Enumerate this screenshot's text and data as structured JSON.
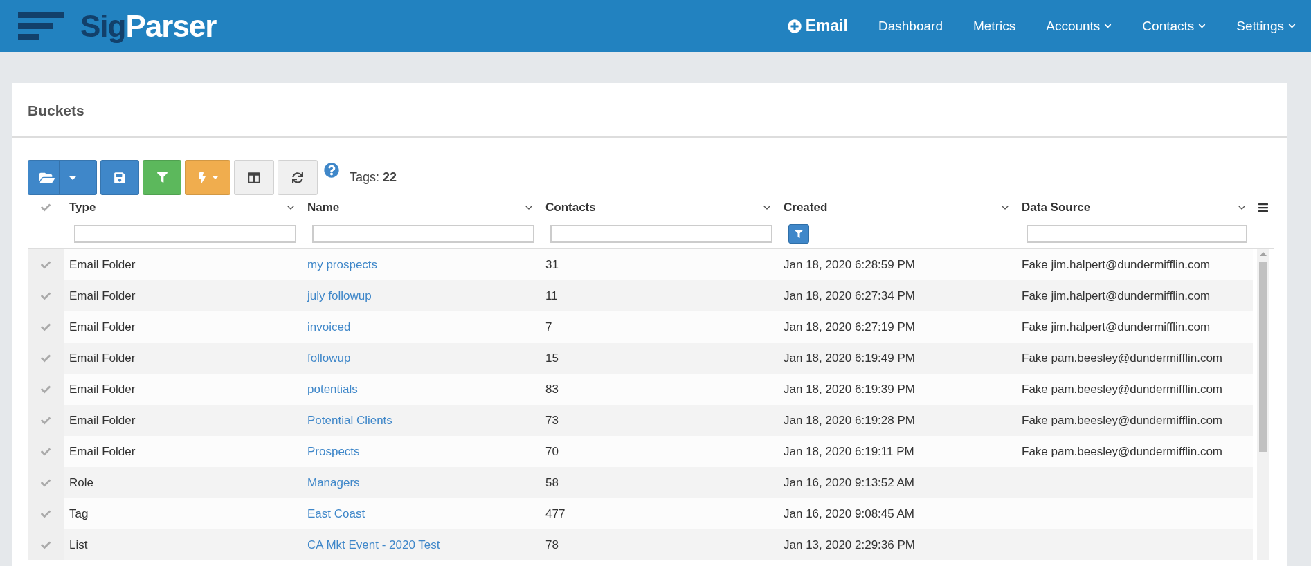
{
  "brand": {
    "part_1": "Sig",
    "part_2": "Parser"
  },
  "nav": [
    {
      "label": "Email",
      "kind": "primary"
    },
    {
      "label": "Dashboard",
      "kind": "link"
    },
    {
      "label": "Metrics",
      "kind": "link"
    },
    {
      "label": "Accounts",
      "kind": "dropdown"
    },
    {
      "label": "Contacts",
      "kind": "dropdown"
    },
    {
      "label": "Settings",
      "kind": "dropdown"
    }
  ],
  "panel": {
    "title": "Buckets"
  },
  "toolbar": {
    "buttons": [
      {
        "kind": "open",
        "color": "#3f87c9"
      },
      {
        "kind": "save",
        "color": "#3f87c9"
      },
      {
        "kind": "filter",
        "color": "#5cb85c"
      },
      {
        "kind": "actions",
        "color": "#f0ad4e"
      },
      {
        "kind": "columns",
        "color": "#f0f0f0"
      },
      {
        "kind": "refresh",
        "color": "#f0f0f0"
      }
    ],
    "tags_label": "Tags:",
    "tags_count": "22"
  },
  "table": {
    "columns": [
      {
        "label": "Type",
        "kind": "text"
      },
      {
        "label": "Name",
        "kind": "text"
      },
      {
        "label": "Contacts",
        "kind": "text"
      },
      {
        "label": "Created",
        "kind": "button"
      },
      {
        "label": "Data Source",
        "kind": "text"
      }
    ],
    "rows": [
      {
        "selected": false,
        "cells": [
          "Email Folder",
          "my prospects",
          "31",
          "Jan 18, 2020 6:28:59 PM",
          "Fake jim.halpert@dundermifflin.com"
        ]
      },
      {
        "selected": false,
        "cells": [
          "Email Folder",
          "july followup",
          "11",
          "Jan 18, 2020 6:27:34 PM",
          "Fake jim.halpert@dundermifflin.com"
        ]
      },
      {
        "selected": false,
        "cells": [
          "Email Folder",
          "invoiced",
          "7",
          "Jan 18, 2020 6:27:19 PM",
          "Fake jim.halpert@dundermifflin.com"
        ]
      },
      {
        "selected": false,
        "cells": [
          "Email Folder",
          "followup",
          "15",
          "Jan 18, 2020 6:19:49 PM",
          "Fake pam.beesley@dundermifflin.com"
        ]
      },
      {
        "selected": false,
        "cells": [
          "Email Folder",
          "potentials",
          "83",
          "Jan 18, 2020 6:19:39 PM",
          "Fake pam.beesley@dundermifflin.com"
        ]
      },
      {
        "selected": false,
        "cells": [
          "Email Folder",
          "Potential Clients",
          "73",
          "Jan 18, 2020 6:19:28 PM",
          "Fake pam.beesley@dundermifflin.com"
        ]
      },
      {
        "selected": false,
        "cells": [
          "Email Folder",
          "Prospects",
          "70",
          "Jan 18, 2020 6:19:11 PM",
          "Fake pam.beesley@dundermifflin.com"
        ]
      },
      {
        "selected": false,
        "cells": [
          "Role",
          "Managers",
          "58",
          "Jan 16, 2020 9:13:52 AM",
          ""
        ]
      },
      {
        "selected": false,
        "cells": [
          "Tag",
          "East Coast",
          "477",
          "Jan 16, 2020 9:08:45 AM",
          ""
        ]
      },
      {
        "selected": false,
        "cells": [
          "List",
          "CA Mkt Event - 2020 Test",
          "78",
          "Jan 13, 2020 2:29:36 PM",
          ""
        ]
      }
    ]
  }
}
